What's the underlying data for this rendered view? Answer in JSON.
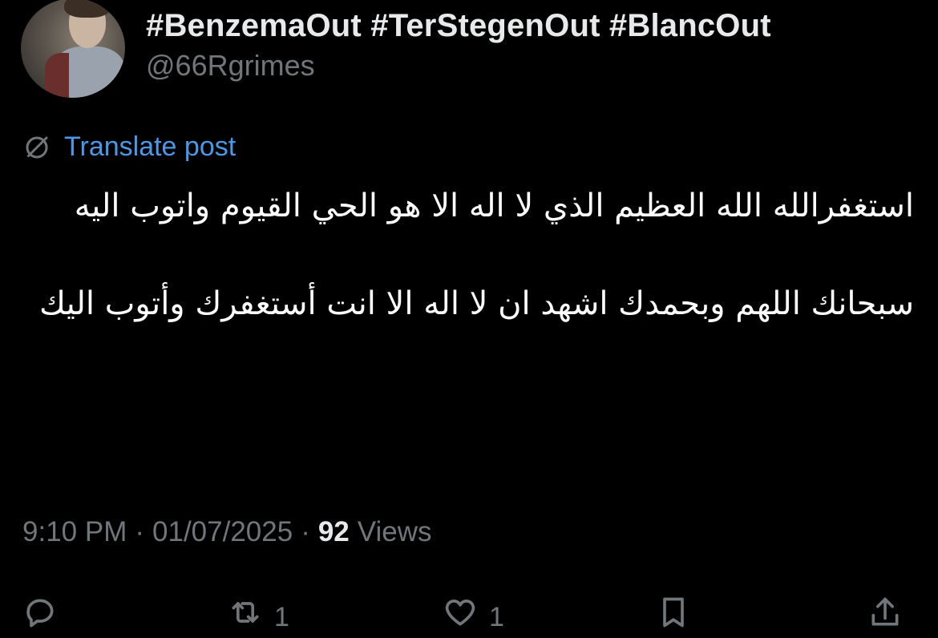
{
  "author": {
    "display_name": "#BenzemaOut #TerStegenOut #BlancOut",
    "handle": "@66Rgrimes"
  },
  "translate": {
    "icon": "globe-slash-icon",
    "label": "Translate post"
  },
  "post": {
    "paragraphs": [
      "استغفرالله الله العظيم الذي لا اله الا هو الحي القيوم واتوب اليه",
      "سبحانك اللهم وبحمدك اشهد ان لا اله الا انت أستغفرك وأتوب اليك"
    ]
  },
  "meta": {
    "time": "9:10 PM",
    "date": "01/07/2025",
    "views_count": "92",
    "views_label": "Views",
    "separator": "·"
  },
  "actions": {
    "reply": {
      "icon": "reply-icon",
      "count": ""
    },
    "repost": {
      "icon": "repost-icon",
      "count": "1"
    },
    "like": {
      "icon": "heart-icon",
      "count": "1"
    },
    "bookmark": {
      "icon": "bookmark-icon",
      "count": ""
    },
    "share": {
      "icon": "share-icon",
      "count": ""
    }
  },
  "colors": {
    "background": "#000000",
    "text_primary": "#e7e9ea",
    "text_secondary": "#71767b",
    "link": "#4a99e9"
  }
}
